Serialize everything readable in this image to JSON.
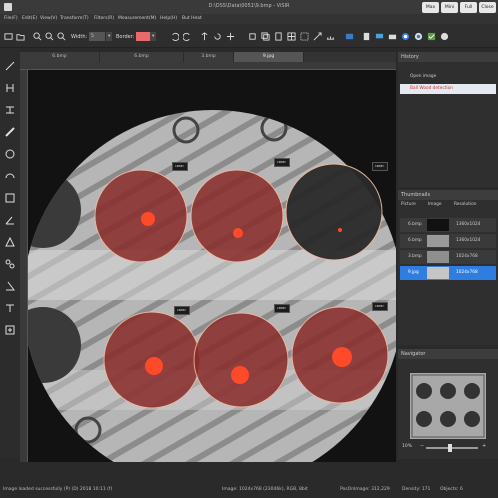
{
  "window": {
    "title": "D:\\DSS\\Data\\0051\\9.bmp - ViSIR",
    "buttons": [
      "Max",
      "Mini",
      "Full",
      "Close"
    ]
  },
  "menu": [
    "File(F)",
    "Edit(E)",
    "View(V)",
    "Transform(T)",
    "Filters(R)",
    "Measurement(M)",
    "Help(H)",
    "But Heat"
  ],
  "toolbar": {
    "width_label": "Width:",
    "width_value": "5",
    "border_label": "Border:",
    "border_color": "#e96a6a"
  },
  "tabs": [
    "6.bmp",
    "6.bmp",
    "3.bmp",
    "9.jpg"
  ],
  "active_tab": 3,
  "canvas": {
    "markers": [
      {
        "lines": [
          "18DF",
          "1230D"
        ]
      },
      {
        "lines": [
          "18DF",
          "1230D"
        ]
      },
      {
        "lines": [
          "18DF",
          "1230D"
        ]
      },
      {
        "lines": [
          "18DF",
          "1230D"
        ]
      },
      {
        "lines": [
          "18DF",
          "1230D"
        ]
      },
      {
        "lines": [
          "18DF",
          "1230D"
        ]
      }
    ]
  },
  "history": {
    "title": "History",
    "items": [
      {
        "label": "Open image",
        "selected": false
      },
      {
        "label": "Ball Wood detection",
        "selected": true
      }
    ]
  },
  "thumbnails": {
    "title": "Thumbnails",
    "headers": [
      "Picture",
      "Image",
      "Resolution"
    ],
    "rows": [
      {
        "name": "6.bmp",
        "resolution": "1360x1024",
        "selected": false,
        "thumb": "dark"
      },
      {
        "name": "6.bmp",
        "resolution": "1360x1024",
        "selected": false,
        "thumb": "light"
      },
      {
        "name": "3.bmp",
        "resolution": "1024x768",
        "selected": false,
        "thumb": "light"
      },
      {
        "name": "9.jpg",
        "resolution": "1024x768",
        "selected": true,
        "thumb": "light"
      }
    ]
  },
  "navigator": {
    "title": "Navigator",
    "zoom": "10%",
    "slider_level": 0.45
  },
  "status": {
    "left": "Image loaded successfully (P) (D) 2018 10:11 (f)",
    "image_info": "Image: 1024x768 (23046k), RGB, 8bit",
    "pos_label": "PosOnImage: 312,229",
    "density": "Density: 171",
    "objects": "Objects: 6"
  },
  "colors": {
    "accent_blue": "#2f7de0",
    "selection_red": "#d04040",
    "overlay": "#b83a3a"
  }
}
